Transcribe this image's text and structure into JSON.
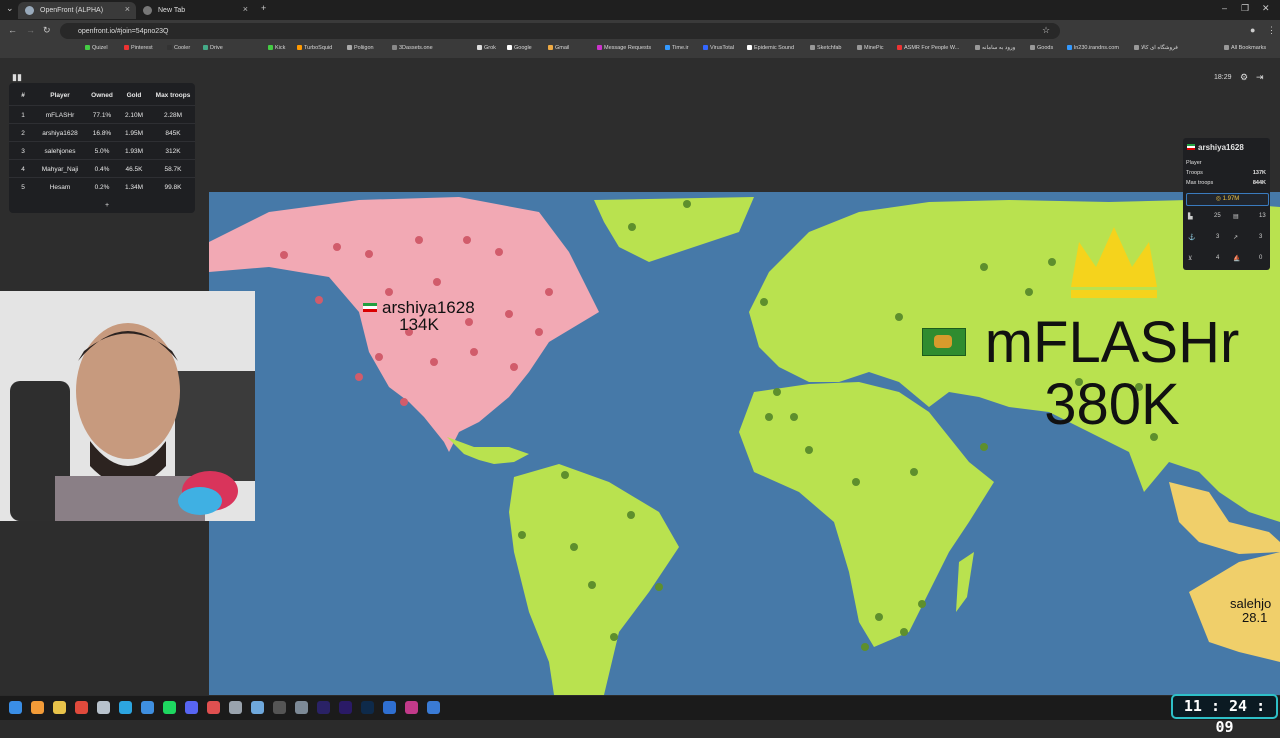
{
  "browser": {
    "tabs": [
      {
        "label": "OpenFront (ALPHA)",
        "active": true
      },
      {
        "label": "New Tab",
        "active": false
      }
    ],
    "url": "openfront.io/#join=54pno23Q",
    "bookmarks": [
      "Quizel",
      "Pinterest",
      "Cooler",
      "Drive",
      "Kick",
      "TurboSquid",
      "Poliigon",
      "3Dassets.one",
      "Grok",
      "Google",
      "Gmail",
      "Message Requests",
      "Time.ir",
      "VirusTotal",
      "Epidemic Sound",
      "Sketchfab",
      "MinePic",
      "ASMR For People W...",
      "ورود به سامانه",
      "Goods",
      "ln230.irandns.com",
      "فروشگاه ای کالا",
      "All Bookmarks"
    ]
  },
  "leaderboard": {
    "headers": [
      "#",
      "Player",
      "Owned",
      "Gold",
      "Max troops"
    ],
    "rows": [
      {
        "rank": "1",
        "player": "mFLASHr",
        "owned": "77.1%",
        "gold": "2.10M",
        "max_troops": "2.28M"
      },
      {
        "rank": "2",
        "player": "arshiya1628",
        "owned": "16.8%",
        "gold": "1.95M",
        "max_troops": "845K"
      },
      {
        "rank": "3",
        "player": "salehjones",
        "owned": "5.0%",
        "gold": "1.93M",
        "max_troops": "312K"
      },
      {
        "rank": "4",
        "player": "Mahyar_Naji",
        "owned": "0.4%",
        "gold": "46.5K",
        "max_troops": "58.7K"
      },
      {
        "rank": "5",
        "player": "Hesam",
        "owned": "0.2%",
        "gold": "1.34M",
        "max_troops": "99.8K"
      }
    ],
    "more_label": "+"
  },
  "hud": {
    "game_time": "18:29"
  },
  "player_panel": {
    "name": "arshiya1628",
    "type": "Player",
    "troops_label": "Troops",
    "troops": "137K",
    "max_troops_label": "Max troops",
    "max_troops": "844K",
    "gold": "1.97M",
    "counts": [
      "25",
      "13",
      "3",
      "3",
      "4",
      "0"
    ]
  },
  "map": {
    "labels": [
      {
        "name": "arshiya1628",
        "troops": "134K"
      },
      {
        "name": "mFLASHr",
        "troops": "380K"
      },
      {
        "name": "salehjo",
        "troops": "28.1"
      }
    ],
    "colors": {
      "ocean": "#4679a8",
      "mflashr": "#b9e24f",
      "arshiya": "#f2a9b4",
      "saleh": "#f0cf6a",
      "crown": "#f5d31c"
    }
  },
  "taskbar": {
    "clock": "11 : 24 : 09"
  }
}
